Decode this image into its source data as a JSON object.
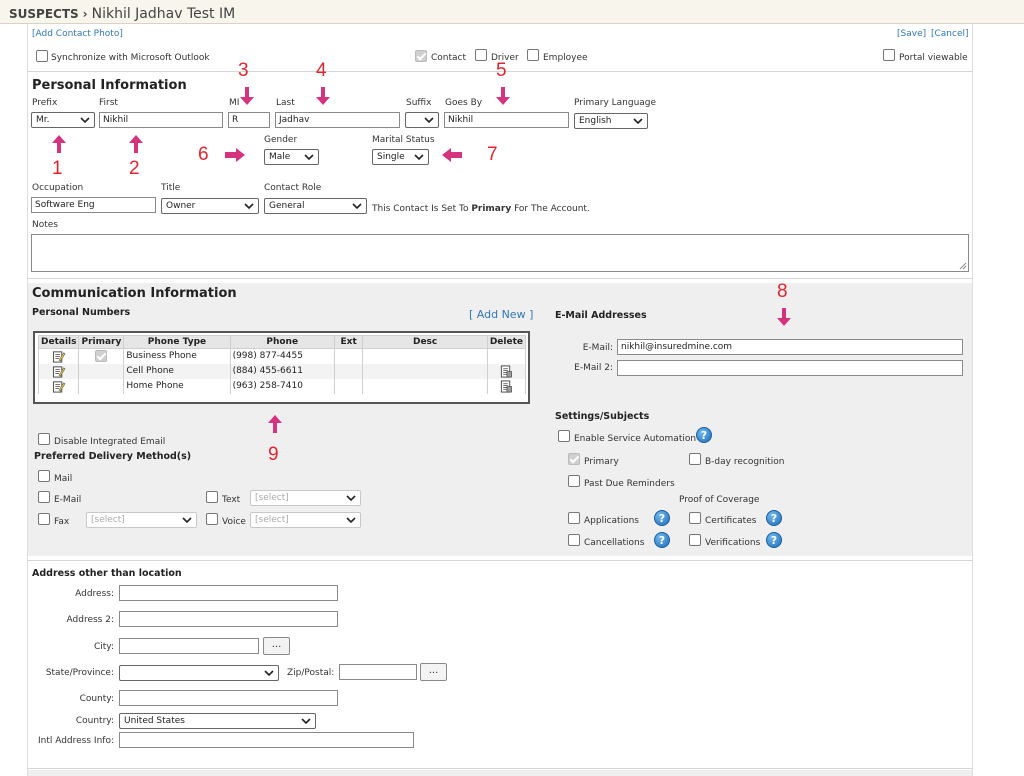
{
  "breadcrumb": {
    "section": "SUSPECTS",
    "name": "Nikhil Jadhav Test IM"
  },
  "top_links": {
    "add_photo": "[Add Contact Photo]",
    "save": "[Save]",
    "cancel": "[Cancel]"
  },
  "sync": {
    "label": "Synchronize with Microsoft Outlook"
  },
  "roles": {
    "contact": "Contact",
    "driver": "Driver",
    "employee": "Employee",
    "portal": "Portal viewable"
  },
  "personal": {
    "heading": "Personal Information",
    "prefix_label": "Prefix",
    "prefix": "Mr.",
    "first_label": "First",
    "first": "Nikhil",
    "mi_label": "MI",
    "mi": "R",
    "last_label": "Last",
    "last": "Jadhav",
    "suffix_label": "Suffix",
    "suffix": "",
    "goesby_label": "Goes By",
    "goesby": "Nikhil",
    "lang_label": "Primary Language",
    "lang": "English",
    "gender_label": "Gender",
    "gender": "Male",
    "marital_label": "Marital Status",
    "marital": "Single",
    "occupation_label": "Occupation",
    "occupation": "Software Eng",
    "title_label": "Title",
    "title": "Owner",
    "role_label": "Contact Role",
    "role": "General",
    "primary_note_pre": "This Contact Is Set To ",
    "primary_note_bold": "Primary",
    "primary_note_post": " For The Account.",
    "notes_label": "Notes"
  },
  "comm": {
    "heading": "Communication Information",
    "personal_numbers": "Personal Numbers",
    "add_new": "[ Add New ]",
    "columns": [
      "Details",
      "Primary",
      "Phone Type",
      "Phone",
      "Ext",
      "Desc",
      "Delete"
    ],
    "phones": [
      {
        "type": "Business Phone",
        "phone": "(998) 877-4455"
      },
      {
        "type": "Cell Phone",
        "phone": "(884) 455-6611"
      },
      {
        "type": "Home Phone",
        "phone": "(963) 258-7410"
      }
    ],
    "disable_email": "Disable Integrated Email",
    "delivery_heading": "Preferred Delivery Method(s)",
    "mail": "Mail",
    "email": "E-Mail",
    "fax": "Fax",
    "text": "Text",
    "voice": "Voice",
    "select_placeholder": "[select]"
  },
  "email": {
    "heading": "E-Mail Addresses",
    "email1_label": "E-Mail:",
    "email1": "nikhil@insuredmine.com",
    "email2_label": "E-Mail 2:",
    "email2": ""
  },
  "settings": {
    "heading": "Settings/Subjects",
    "service_automation": "Enable Service Automation",
    "primary": "Primary",
    "bday": "B-day recognition",
    "past_due": "Past Due Reminders",
    "proof": "Proof of Coverage",
    "applications": "Applications",
    "certificates": "Certificates",
    "cancellations": "Cancellations",
    "verifications": "Verifications",
    "help_glyph": "?"
  },
  "address": {
    "heading": "Address other than location",
    "address_label": "Address:",
    "address2_label": "Address 2:",
    "city_label": "City:",
    "state_label": "State/Province:",
    "zip_label": "Zip/Postal:",
    "county_label": "County:",
    "country_label": "Country:",
    "country": "United States",
    "intl_label": "Intl Address Info:",
    "dots": "..."
  },
  "annotations": [
    "1",
    "2",
    "3",
    "4",
    "5",
    "6",
    "7",
    "8",
    "9"
  ],
  "colors": {
    "annotation": "#e0252f",
    "arrow": "#d6337f",
    "link": "#2f78b8",
    "section_bg": "#efefef"
  }
}
